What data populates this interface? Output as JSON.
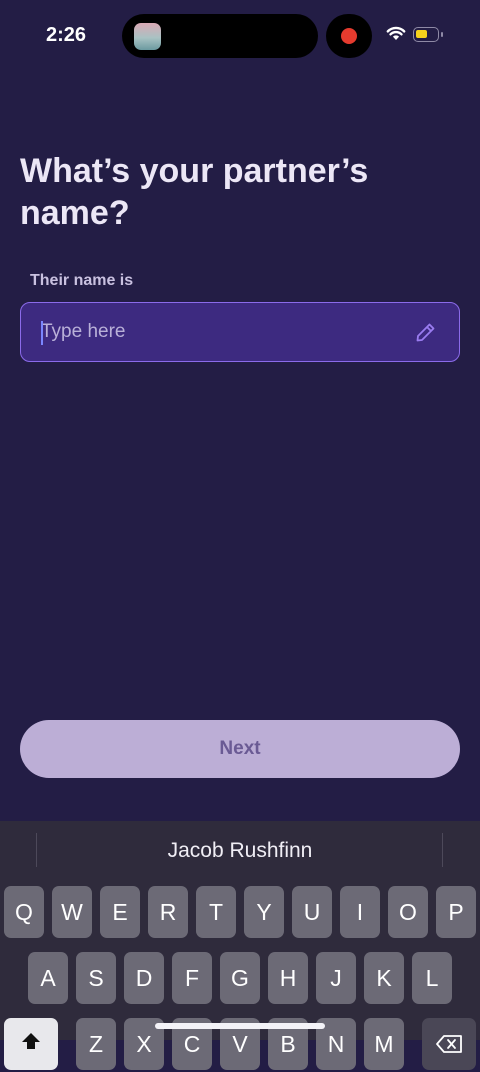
{
  "status_bar": {
    "time": "2:26",
    "battery_level": 0.6,
    "recording_color": "#e53b2e"
  },
  "header": {
    "title": "What’s your partner’s name?"
  },
  "form": {
    "label": "Their name is",
    "input_value": "",
    "input_placeholder": "Type here",
    "edit_icon": "pencil-icon"
  },
  "next_button": {
    "label": "Next"
  },
  "keyboard": {
    "suggestion": "Jacob Rushfinn",
    "rows": [
      [
        "Q",
        "W",
        "E",
        "R",
        "T",
        "Y",
        "U",
        "I",
        "O",
        "P"
      ],
      [
        "A",
        "S",
        "D",
        "F",
        "G",
        "H",
        "J",
        "K",
        "L"
      ],
      [
        "Z",
        "X",
        "C",
        "V",
        "B",
        "N",
        "M"
      ]
    ]
  },
  "colors": {
    "background": "#231d45",
    "field_bg": "#3d2a80",
    "field_border": "#8b6bea",
    "button_bg": "#bcaed6",
    "button_text": "#6a5a94"
  }
}
